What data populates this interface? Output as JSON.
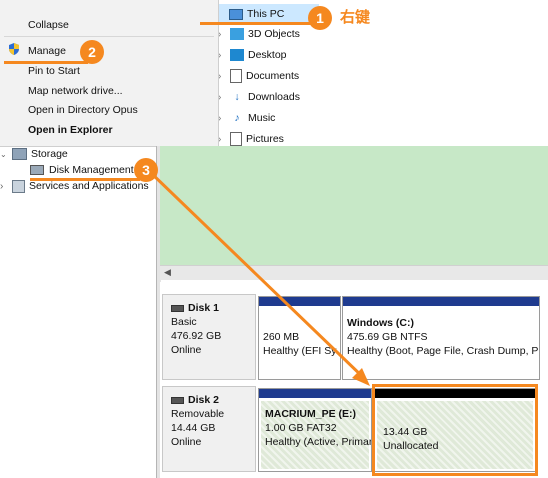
{
  "explorer_tree": {
    "selected": "This PC",
    "items": [
      "3D Objects",
      "Desktop",
      "Documents",
      "Downloads",
      "Music",
      "Pictures"
    ]
  },
  "context_menu": {
    "items": [
      "Collapse",
      "Manage",
      "Pin to Start",
      "Map network drive...",
      "Open in Directory Opus",
      "Open in Explorer"
    ]
  },
  "mmc_tree": {
    "storage": "Storage",
    "disk_management": "Disk Management",
    "services": "Services and Applications"
  },
  "disks": [
    {
      "name": "Disk 1",
      "type": "Basic",
      "size": "476.92 GB",
      "status": "Online",
      "partitions": [
        {
          "label": "",
          "size_fs": "260 MB",
          "status": "Healthy (EFI Sy"
        },
        {
          "label": "Windows  (C:)",
          "size_fs": "475.69 GB NTFS",
          "status": "Healthy (Boot, Page File, Crash Dump, P"
        }
      ]
    },
    {
      "name": "Disk 2",
      "type": "Removable",
      "size": "14.44 GB",
      "status": "Online",
      "partitions": [
        {
          "label": "MACRIUM_PE  (E:)",
          "size_fs": "1.00 GB FAT32",
          "status": "Healthy (Active, Primar"
        },
        {
          "label": "",
          "size_fs": "13.44 GB",
          "status": "Unallocated"
        }
      ]
    }
  ],
  "annotations": {
    "step1": "1",
    "step2": "2",
    "step3": "3",
    "right_click_label": "右键",
    "accent_color": "#f5881f"
  }
}
